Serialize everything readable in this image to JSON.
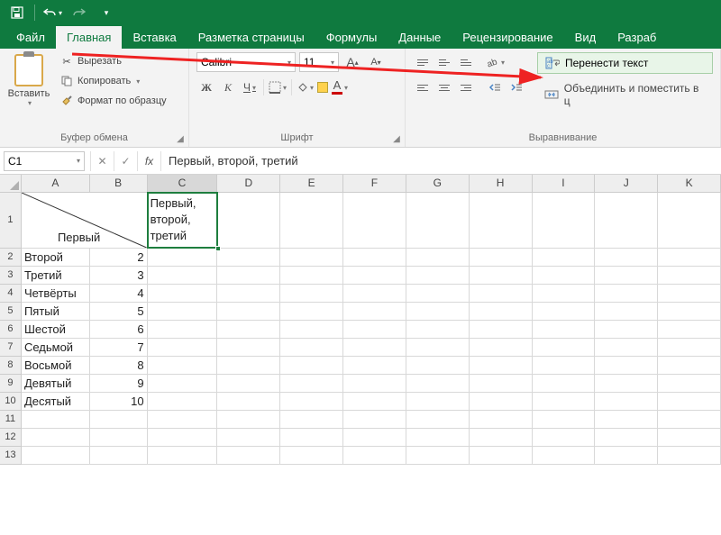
{
  "titlebar": {
    "save_tooltip": "Сохранить",
    "undo_tooltip": "Отменить",
    "redo_tooltip": "Вернуть"
  },
  "tabs": {
    "file": "Файл",
    "home": "Главная",
    "insert": "Вставка",
    "pagelayout": "Разметка страницы",
    "formulas": "Формулы",
    "data": "Данные",
    "review": "Рецензирование",
    "view": "Вид",
    "developer": "Разраб"
  },
  "ribbon": {
    "clipboard": {
      "paste": "Вставить",
      "cut": "Вырезать",
      "copy": "Копировать",
      "format_painter": "Формат по образцу",
      "group_label": "Буфер обмена"
    },
    "font": {
      "name": "Calibri",
      "size": "11",
      "bold": "Ж",
      "italic": "К",
      "underline": "Ч",
      "font_color_char": "A",
      "group_label": "Шрифт"
    },
    "alignment": {
      "wrap_text": "Перенести текст",
      "merge": "Объединить и поместить в ц",
      "group_label": "Выравнивание"
    }
  },
  "formula_bar": {
    "cell_ref": "C1",
    "content": "Первый, второй, третий"
  },
  "grid": {
    "columns": [
      "A",
      "B",
      "C",
      "D",
      "E",
      "F",
      "G",
      "H",
      "I",
      "J",
      "K"
    ],
    "row1": {
      "AB_merged": "Первый",
      "C": "Первый, второй, третий"
    },
    "rows": [
      {
        "n": 2,
        "a": "Второй",
        "b": "2"
      },
      {
        "n": 3,
        "a": "Третий",
        "b": "3"
      },
      {
        "n": 4,
        "a": "Четвёрты",
        "b": "4"
      },
      {
        "n": 5,
        "a": "Пятый",
        "b": "5"
      },
      {
        "n": 6,
        "a": "Шестой",
        "b": "6"
      },
      {
        "n": 7,
        "a": "Седьмой",
        "b": "7"
      },
      {
        "n": 8,
        "a": "Восьмой",
        "b": "8"
      },
      {
        "n": 9,
        "a": "Девятый",
        "b": "9"
      },
      {
        "n": 10,
        "a": "Десятый",
        "b": "10"
      }
    ],
    "empty_rows": [
      11,
      12,
      13
    ]
  }
}
